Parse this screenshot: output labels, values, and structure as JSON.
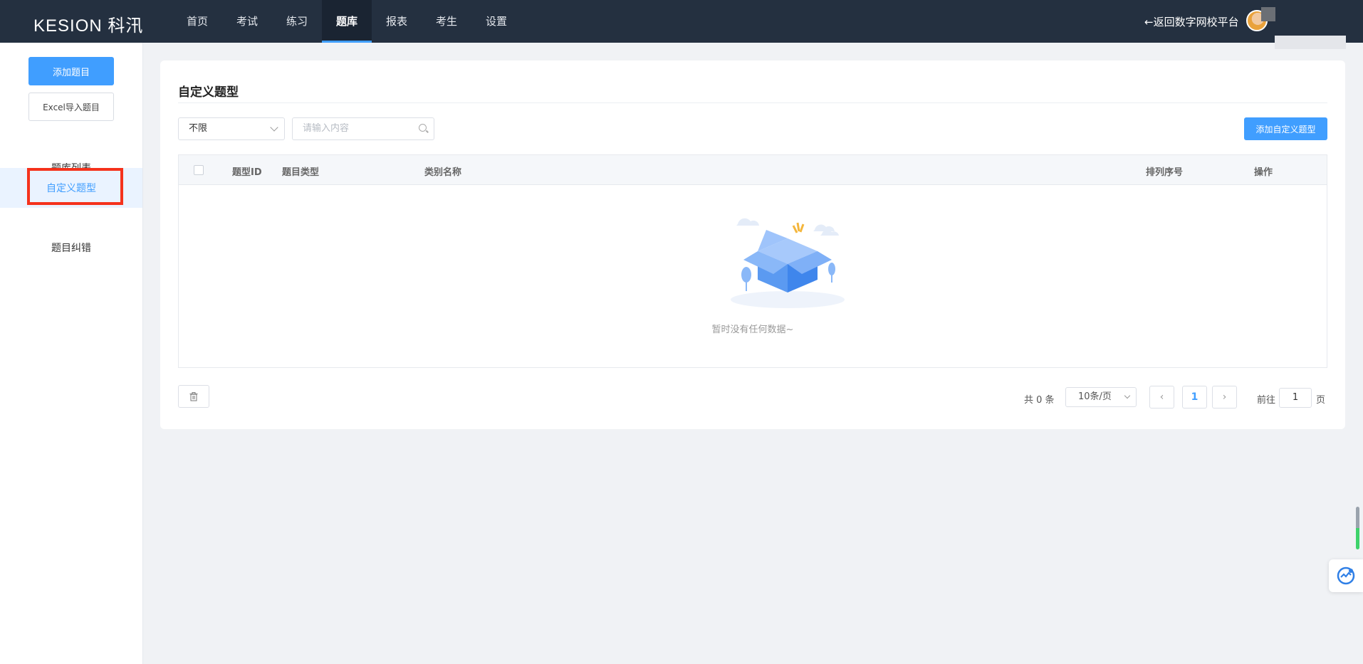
{
  "header": {
    "logo": "KESION 科汛",
    "nav": [
      {
        "label": "首页"
      },
      {
        "label": "考试"
      },
      {
        "label": "练习"
      },
      {
        "label": "题库",
        "active": true
      },
      {
        "label": "报表"
      },
      {
        "label": "考生"
      },
      {
        "label": "设置"
      }
    ],
    "back_link": "←返回数字网校平台"
  },
  "sidebar": {
    "add_button": "添加题目",
    "import_button": "Excel导入题目",
    "items": [
      {
        "label": "题库列表"
      },
      {
        "label": "自定义题型",
        "active": true
      },
      {
        "label": "题目纠错"
      }
    ]
  },
  "main": {
    "title": "自定义题型",
    "filter_select": "不限",
    "search_placeholder": "请输入内容",
    "add_type_button": "添加自定义题型",
    "table": {
      "columns": [
        "题型ID",
        "题目类型",
        "类别名称",
        "排列序号",
        "操作"
      ],
      "rows": [],
      "empty_text": "暂时没有任何数据~"
    },
    "pagination": {
      "total_text": "共 0 条",
      "page_size": "10条/页",
      "current_page": "1",
      "goto_prefix": "前往",
      "goto_value": "1",
      "goto_suffix": "页"
    }
  },
  "colors": {
    "topbar": "#243040",
    "primary": "#409eff",
    "highlight_box": "#f5321c"
  },
  "icons": {
    "search": "search-icon",
    "trash": "trash-icon",
    "prev": "chevron-left-icon",
    "next": "chevron-right-icon"
  }
}
